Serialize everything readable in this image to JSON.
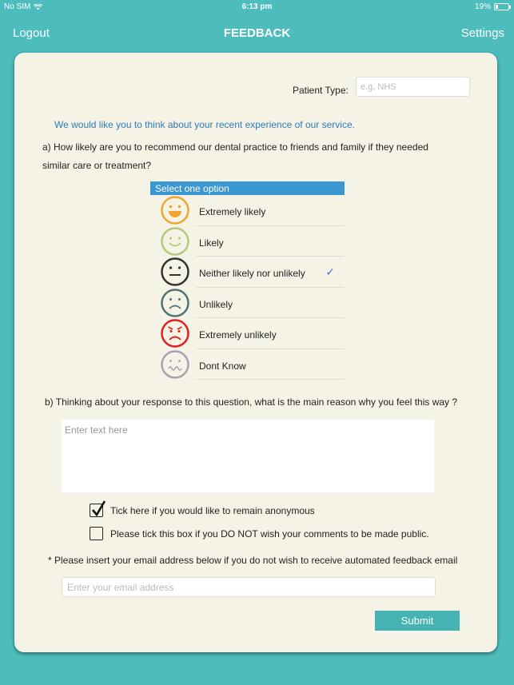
{
  "status_bar": {
    "carrier": "No SIM",
    "time": "6:13 pm",
    "battery": "19%"
  },
  "nav": {
    "left": "Logout",
    "title": "FEEDBACK",
    "right": "Settings"
  },
  "patient_type": {
    "label": "Patient Type:",
    "placeholder": "e.g, NHS"
  },
  "intro": "We would like you to think about your recent experience of our service.",
  "question_a": "a) How likely are you to recommend our dental practice to friends and family if they needed similar care or treatment?",
  "options_header": "Select one option",
  "options": [
    {
      "label": "Extremely likely",
      "icon": "very-happy-face-icon",
      "color": "#f0a530",
      "selected": false
    },
    {
      "label": "Likely",
      "icon": "happy-face-icon",
      "color": "#b6c77a",
      "selected": false
    },
    {
      "label": "Neither likely nor unlikely",
      "icon": "neutral-face-icon",
      "color": "#333333",
      "selected": true
    },
    {
      "label": "Unlikely",
      "icon": "sad-face-icon",
      "color": "#4e7278",
      "selected": false
    },
    {
      "label": "Extremely unlikely",
      "icon": "angry-face-icon",
      "color": "#e02020",
      "selected": false
    },
    {
      "label": "Dont Know",
      "icon": "confused-face-icon",
      "color": "#a8a0b3",
      "selected": false
    }
  ],
  "question_b": "b) Thinking about your response to this question, what is the main reason why you feel this way ?",
  "reason_placeholder": "Enter text here",
  "anonymous": {
    "label": "Tick here if you would like to remain anonymous",
    "checked": true
  },
  "not_public": {
    "label": "Please tick this box if you DO NOT wish your comments to be made public.",
    "checked": false
  },
  "email_note": "* Please insert your email address below if you do not wish to receive automated feedback email",
  "email_placeholder": "Enter your email address",
  "submit_label": "Submit"
}
